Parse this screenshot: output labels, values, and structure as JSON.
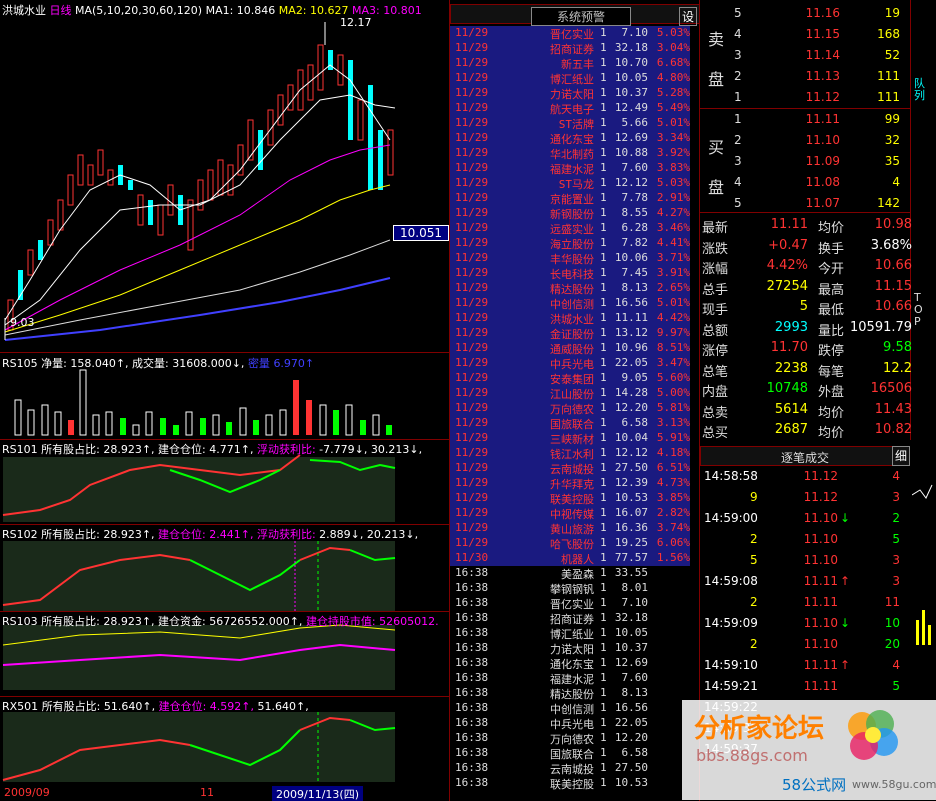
{
  "chart": {
    "name": "洪城水业",
    "period": "日线",
    "ma_params": "MA(5,10,20,30,60,120)",
    "ma1": "MA1: 10.846",
    "ma2": "MA2: 10.627",
    "ma3": "MA3: 10.801",
    "high_label": "12.17",
    "low_label": "9.03",
    "price_tag": "10.051",
    "rs105": "RS105",
    "rs105_a": "净量: 158.040↑,",
    "rs105_b": "成交量: 31608.000↓,",
    "rs105_c": "密量",
    "rs105_d": "6.970↑",
    "rs101": "RS101",
    "rs101_a": "所有股占比: 28.923↑,",
    "rs101_b": "建仓仓位: 4.771↑,",
    "rs101_c": "浮动获利比:",
    "rs101_d": "-7.779↓,",
    "rs101_e": "30.213↓,",
    "rs102": "RS102",
    "rs102_a": "所有股占比: 28.923↑,",
    "rs102_b": "建仓仓位: 2.441↑,",
    "rs102_c": "浮动获利比:",
    "rs102_d": "2.889↓,",
    "rs102_e": "20.213↓,",
    "rs103": "RS103",
    "rs103_a": "所有股占比: 28.923↑,",
    "rs103_b": "建仓资金: 56726552.000↑,",
    "rs103_c": "建仓持股市值:",
    "rs103_d": "52605012.",
    "rx501": "RX501",
    "rx501_a": "所有股占比: 51.640↑,",
    "rx501_b": "建仓仓位: 4.592↑,",
    "rx501_c": "51.640↑,",
    "date_left": "2009/09",
    "date_mid": "11",
    "date_cursor": "2009/11/13(四)"
  },
  "alerts": {
    "title": "系统预警",
    "settings_button": "设",
    "rows": [
      {
        "d": "11/29",
        "n": "晋亿实业",
        "q": "1",
        "p": "7.10",
        "c": "5.03%"
      },
      {
        "d": "11/29",
        "n": "招商证券",
        "q": "1",
        "p": "32.18",
        "c": "3.04%"
      },
      {
        "d": "11/29",
        "n": "新五丰",
        "q": "1",
        "p": "10.70",
        "c": "6.68%"
      },
      {
        "d": "11/29",
        "n": "博汇纸业",
        "q": "1",
        "p": "10.05",
        "c": "4.80%"
      },
      {
        "d": "11/29",
        "n": "力诺太阳",
        "q": "1",
        "p": "10.37",
        "c": "5.28%"
      },
      {
        "d": "11/29",
        "n": "航天电子",
        "q": "1",
        "p": "12.49",
        "c": "5.49%"
      },
      {
        "d": "11/29",
        "n": "ST活牌",
        "q": "1",
        "p": "5.66",
        "c": "5.01%"
      },
      {
        "d": "11/29",
        "n": "通化东宝",
        "q": "1",
        "p": "12.69",
        "c": "3.34%"
      },
      {
        "d": "11/29",
        "n": "华北制药",
        "q": "1",
        "p": "10.88",
        "c": "3.92%"
      },
      {
        "d": "11/29",
        "n": "福建水泥",
        "q": "1",
        "p": "7.60",
        "c": "3.83%"
      },
      {
        "d": "11/29",
        "n": "ST马龙",
        "q": "1",
        "p": "12.12",
        "c": "5.03%"
      },
      {
        "d": "11/29",
        "n": "京能置业",
        "q": "1",
        "p": "7.78",
        "c": "2.91%"
      },
      {
        "d": "11/29",
        "n": "新钢股份",
        "q": "1",
        "p": "8.55",
        "c": "4.27%"
      },
      {
        "d": "11/29",
        "n": "远盛实业",
        "q": "1",
        "p": "6.28",
        "c": "3.46%"
      },
      {
        "d": "11/29",
        "n": "海立股份",
        "q": "1",
        "p": "7.82",
        "c": "4.41%"
      },
      {
        "d": "11/29",
        "n": "丰华股份",
        "q": "1",
        "p": "10.06",
        "c": "3.71%"
      },
      {
        "d": "11/29",
        "n": "长电科技",
        "q": "1",
        "p": "7.45",
        "c": "3.91%"
      },
      {
        "d": "11/29",
        "n": "精达股份",
        "q": "1",
        "p": "8.13",
        "c": "2.65%"
      },
      {
        "d": "11/29",
        "n": "中创信测",
        "q": "1",
        "p": "16.56",
        "c": "5.01%"
      },
      {
        "d": "11/29",
        "n": "洪城水业",
        "q": "1",
        "p": "11.11",
        "c": "4.42%"
      },
      {
        "d": "11/29",
        "n": "金证股份",
        "q": "1",
        "p": "13.12",
        "c": "9.97%"
      },
      {
        "d": "11/29",
        "n": "通威股份",
        "q": "1",
        "p": "10.96",
        "c": "8.51%"
      },
      {
        "d": "11/29",
        "n": "中兵光电",
        "q": "1",
        "p": "22.05",
        "c": "3.47%"
      },
      {
        "d": "11/29",
        "n": "安泰集团",
        "q": "1",
        "p": "9.05",
        "c": "5.60%"
      },
      {
        "d": "11/29",
        "n": "江山股份",
        "q": "1",
        "p": "14.28",
        "c": "5.00%"
      },
      {
        "d": "11/29",
        "n": "万向德农",
        "q": "1",
        "p": "12.20",
        "c": "5.81%"
      },
      {
        "d": "11/29",
        "n": "国旅联合",
        "q": "1",
        "p": "6.58",
        "c": "3.13%"
      },
      {
        "d": "11/29",
        "n": "三峡新材",
        "q": "1",
        "p": "10.04",
        "c": "5.91%"
      },
      {
        "d": "11/29",
        "n": "钱江水利",
        "q": "1",
        "p": "12.12",
        "c": "4.18%"
      },
      {
        "d": "11/29",
        "n": "云南城投",
        "q": "1",
        "p": "27.50",
        "c": "6.51%"
      },
      {
        "d": "11/29",
        "n": "升华拜克",
        "q": "1",
        "p": "12.39",
        "c": "4.73%"
      },
      {
        "d": "11/29",
        "n": "联美控股",
        "q": "1",
        "p": "10.53",
        "c": "3.85%"
      },
      {
        "d": "11/29",
        "n": "中视传媒",
        "q": "1",
        "p": "16.07",
        "c": "2.82%"
      },
      {
        "d": "11/29",
        "n": "黄山旅游",
        "q": "1",
        "p": "16.36",
        "c": "3.74%"
      },
      {
        "d": "11/29",
        "n": "哈飞股份",
        "q": "1",
        "p": "19.25",
        "c": "6.06%"
      },
      {
        "d": "11/30",
        "n": "机器人",
        "q": "1",
        "p": "77.57",
        "c": "1.56%"
      },
      {
        "d": "16:38",
        "n": "美盈森",
        "q": "1",
        "p": "33.55",
        "c": ""
      },
      {
        "d": "16:38",
        "n": "攀钢钢钒",
        "q": "1",
        "p": "8.01",
        "c": ""
      },
      {
        "d": "16:38",
        "n": "晋亿实业",
        "q": "1",
        "p": "7.10",
        "c": ""
      },
      {
        "d": "16:38",
        "n": "招商证券",
        "q": "1",
        "p": "32.18",
        "c": ""
      },
      {
        "d": "16:38",
        "n": "博汇纸业",
        "q": "1",
        "p": "10.05",
        "c": ""
      },
      {
        "d": "16:38",
        "n": "力诺太阳",
        "q": "1",
        "p": "10.37",
        "c": ""
      },
      {
        "d": "16:38",
        "n": "通化东宝",
        "q": "1",
        "p": "12.69",
        "c": ""
      },
      {
        "d": "16:38",
        "n": "福建水泥",
        "q": "1",
        "p": "7.60",
        "c": ""
      },
      {
        "d": "16:38",
        "n": "精达股份",
        "q": "1",
        "p": "8.13",
        "c": ""
      },
      {
        "d": "16:38",
        "n": "中创信测",
        "q": "1",
        "p": "16.56",
        "c": ""
      },
      {
        "d": "16:38",
        "n": "中兵光电",
        "q": "1",
        "p": "22.05",
        "c": ""
      },
      {
        "d": "16:38",
        "n": "万向德农",
        "q": "1",
        "p": "12.20",
        "c": ""
      },
      {
        "d": "16:38",
        "n": "国旅联合",
        "q": "1",
        "p": "6.58",
        "c": ""
      },
      {
        "d": "16:38",
        "n": "云南城投",
        "q": "1",
        "p": "27.50",
        "c": ""
      },
      {
        "d": "16:38",
        "n": "联美控股",
        "q": "1",
        "p": "10.53",
        "c": ""
      }
    ]
  },
  "orderbook": {
    "sell_label": "卖盘",
    "buy_label": "买盘",
    "sell": [
      {
        "lv": "5",
        "p": "11.16",
        "v": "19"
      },
      {
        "lv": "4",
        "p": "11.15",
        "v": "168"
      },
      {
        "lv": "3",
        "p": "11.14",
        "v": "52"
      },
      {
        "lv": "2",
        "p": "11.13",
        "v": "111"
      },
      {
        "lv": "1",
        "p": "11.12",
        "v": "111"
      }
    ],
    "buy": [
      {
        "lv": "1",
        "p": "11.11",
        "v": "99"
      },
      {
        "lv": "2",
        "p": "11.10",
        "v": "32"
      },
      {
        "lv": "3",
        "p": "11.09",
        "v": "35"
      },
      {
        "lv": "4",
        "p": "11.08",
        "v": "4"
      },
      {
        "lv": "5",
        "p": "11.07",
        "v": "142"
      }
    ],
    "side_tab": "队列"
  },
  "quote": {
    "rows": [
      {
        "l1": "最新",
        "v1": "11.11",
        "l2": "均价",
        "v2": "10.98"
      },
      {
        "l1": "涨跌",
        "v1": "+0.47",
        "l2": "换手",
        "v2": "3.68%"
      },
      {
        "l1": "涨幅",
        "v1": "4.42%",
        "l2": "今开",
        "v2": "10.66"
      },
      {
        "l1": "总手",
        "v1": "27254",
        "l2": "最高",
        "v2": "11.15"
      },
      {
        "l1": "现手",
        "v1": "5",
        "l2": "最低",
        "v2": "10.66"
      },
      {
        "l1": "总额",
        "v1": "2993",
        "l2": "量比",
        "v2": "10591.79"
      },
      {
        "l1": "涨停",
        "v1": "11.70",
        "l2": "跌停",
        "v2": "9.58"
      },
      {
        "l1": "总笔",
        "v1": "2238",
        "l2": "每笔",
        "v2": "12.2"
      },
      {
        "l1": "内盘",
        "v1": "10748",
        "l2": "外盘",
        "v2": "16506"
      },
      {
        "l1": "总卖",
        "v1": "5614",
        "l2": "均价",
        "v2": "11.43"
      },
      {
        "l1": "总买",
        "v1": "2687",
        "l2": "均价",
        "v2": "10.82"
      }
    ],
    "side_tab": "TOP"
  },
  "ticks": {
    "title": "逐笔成交",
    "detail_button": "细",
    "rows": [
      {
        "t": "14:58:58",
        "p": "11.12",
        "a": "",
        "v": "4"
      },
      {
        "t": "9",
        "p": "11.12",
        "a": "",
        "v": "3"
      },
      {
        "t": "14:59:00",
        "p": "11.10",
        "a": "↓",
        "v": "2"
      },
      {
        "t": "2",
        "p": "11.10",
        "a": "",
        "v": "5"
      },
      {
        "t": "5",
        "p": "11.10",
        "a": "",
        "v": "3"
      },
      {
        "t": "14:59:08",
        "p": "11.11",
        "a": "↑",
        "v": "3"
      },
      {
        "t": "2",
        "p": "11.11",
        "a": "",
        "v": "11"
      },
      {
        "t": "14:59:09",
        "p": "11.10",
        "a": "↓",
        "v": "10"
      },
      {
        "t": "2",
        "p": "11.10",
        "a": "",
        "v": "20"
      },
      {
        "t": "14:59:10",
        "p": "11.11",
        "a": "↑",
        "v": "4"
      },
      {
        "t": "14:59:21",
        "p": "11.11",
        "a": "",
        "v": "5"
      },
      {
        "t": "14:59:22",
        "p": "",
        "a": "",
        "v": ""
      },
      {
        "t": "14:59:30",
        "p": "",
        "a": "",
        "v": ""
      },
      {
        "t": "14:59:37",
        "p": "",
        "a": "",
        "v": ""
      }
    ]
  },
  "watermark": {
    "title": "分析家论坛",
    "url": "bbs.88gs.com",
    "brand": "58公式网",
    "brand_url": "www.58gu.com"
  },
  "colors": {
    "up": "#ff3333",
    "down": "#00ffff",
    "vol_green": "#00ff00",
    "ma_white": "#ffffff",
    "ma_magenta": "#ff00ff",
    "ma_yellow": "#ffff00",
    "ma_blue": "#4040ff",
    "bg": "#000000",
    "grid": "#800000"
  }
}
